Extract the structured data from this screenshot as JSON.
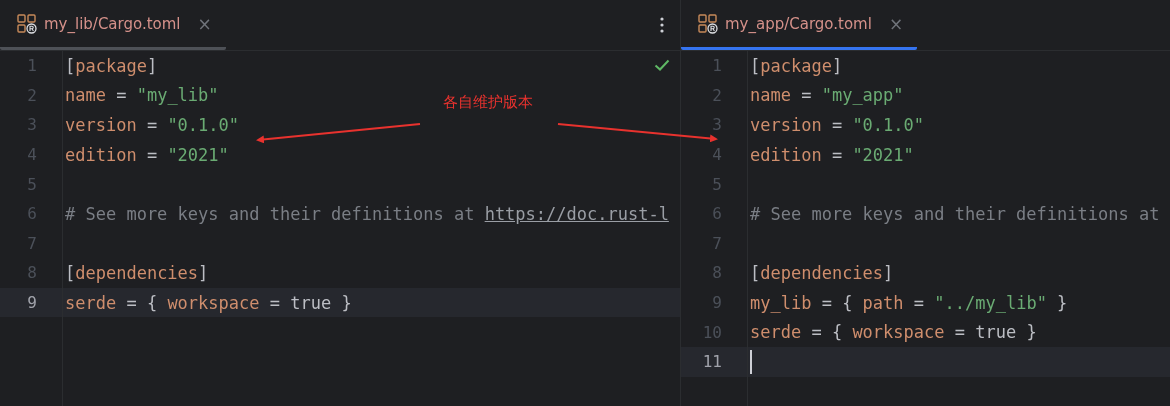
{
  "panes": [
    {
      "tab": {
        "label": "my_lib/Cargo.toml",
        "close": "×",
        "selected": false
      },
      "inspection_ok": true,
      "more_menu": true,
      "lines": [
        {
          "number": "1",
          "current": false,
          "tokens": [
            {
              "kind": "punct",
              "text": "["
            },
            {
              "kind": "key",
              "text": "package"
            },
            {
              "kind": "punct",
              "text": "]"
            }
          ]
        },
        {
          "number": "2",
          "current": false,
          "tokens": [
            {
              "kind": "key",
              "text": "name"
            },
            {
              "kind": "punct",
              "text": " = "
            },
            {
              "kind": "string",
              "text": "\"my_lib\""
            }
          ]
        },
        {
          "number": "3",
          "current": false,
          "tokens": [
            {
              "kind": "key",
              "text": "version"
            },
            {
              "kind": "punct",
              "text": " = "
            },
            {
              "kind": "string",
              "text": "\"0.1.0\""
            }
          ]
        },
        {
          "number": "4",
          "current": false,
          "tokens": [
            {
              "kind": "key",
              "text": "edition"
            },
            {
              "kind": "punct",
              "text": " = "
            },
            {
              "kind": "string",
              "text": "\"2021\""
            }
          ]
        },
        {
          "number": "5",
          "current": false
        },
        {
          "number": "6",
          "current": false,
          "tokens": [
            {
              "kind": "comment",
              "text": "# See more keys and their definitions at "
            },
            {
              "kind": "link",
              "text": "https://doc.rust-l"
            }
          ]
        },
        {
          "number": "7",
          "current": false
        },
        {
          "number": "8",
          "current": false,
          "tokens": [
            {
              "kind": "punct",
              "text": "["
            },
            {
              "kind": "key",
              "text": "dependencies"
            },
            {
              "kind": "punct",
              "text": "]"
            }
          ]
        },
        {
          "number": "9",
          "current": true,
          "tokens": [
            {
              "kind": "key",
              "text": "serde"
            },
            {
              "kind": "punct",
              "text": " = { "
            },
            {
              "kind": "key",
              "text": "workspace"
            },
            {
              "kind": "punct",
              "text": " = true }"
            }
          ]
        }
      ]
    },
    {
      "tab": {
        "label": "my_app/Cargo.toml",
        "close": "×",
        "selected": true
      },
      "inspection_ok": false,
      "more_menu": false,
      "lines": [
        {
          "number": "1",
          "current": false,
          "tokens": [
            {
              "kind": "punct",
              "text": "["
            },
            {
              "kind": "key",
              "text": "package"
            },
            {
              "kind": "punct",
              "text": "]"
            }
          ]
        },
        {
          "number": "2",
          "current": false,
          "tokens": [
            {
              "kind": "key",
              "text": "name"
            },
            {
              "kind": "punct",
              "text": " = "
            },
            {
              "kind": "string",
              "text": "\"my_app\""
            }
          ]
        },
        {
          "number": "3",
          "current": false,
          "tokens": [
            {
              "kind": "key",
              "text": "version"
            },
            {
              "kind": "punct",
              "text": " = "
            },
            {
              "kind": "string",
              "text": "\"0.1.0\""
            }
          ]
        },
        {
          "number": "4",
          "current": false,
          "tokens": [
            {
              "kind": "key",
              "text": "edition"
            },
            {
              "kind": "punct",
              "text": " = "
            },
            {
              "kind": "string",
              "text": "\"2021\""
            }
          ]
        },
        {
          "number": "5",
          "current": false
        },
        {
          "number": "6",
          "current": false,
          "tokens": [
            {
              "kind": "comment",
              "text": "# See more keys and their definitions at"
            }
          ]
        },
        {
          "number": "7",
          "current": false
        },
        {
          "number": "8",
          "current": false,
          "tokens": [
            {
              "kind": "punct",
              "text": "["
            },
            {
              "kind": "key",
              "text": "dependencies"
            },
            {
              "kind": "punct",
              "text": "]"
            }
          ]
        },
        {
          "number": "9",
          "current": false,
          "tokens": [
            {
              "kind": "key",
              "text": "my_lib"
            },
            {
              "kind": "punct",
              "text": " = { "
            },
            {
              "kind": "key",
              "text": "path"
            },
            {
              "kind": "punct",
              "text": " = "
            },
            {
              "kind": "string",
              "text": "\"../my_lib\""
            },
            {
              "kind": "punct",
              "text": " }"
            }
          ]
        },
        {
          "number": "10",
          "current": false,
          "tokens": [
            {
              "kind": "key",
              "text": "serde"
            },
            {
              "kind": "punct",
              "text": " = { "
            },
            {
              "kind": "key",
              "text": "workspace"
            },
            {
              "kind": "punct",
              "text": " = true }"
            }
          ]
        },
        {
          "number": "11",
          "current": true
        }
      ]
    }
  ],
  "annotation": {
    "text": "各自维护版本"
  }
}
